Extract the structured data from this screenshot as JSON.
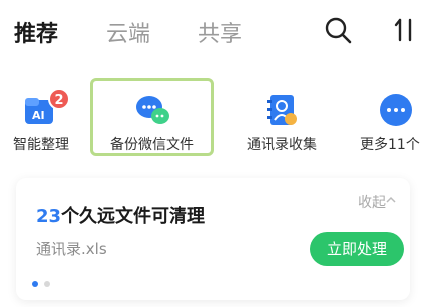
{
  "tabs": [
    {
      "label": "推荐",
      "active": true
    },
    {
      "label": "云端",
      "active": false
    },
    {
      "label": "共享",
      "active": false
    }
  ],
  "header_icons": [
    "search-icon",
    "sort-icon"
  ],
  "shortcuts": [
    {
      "label": "智能整理",
      "icon": "smart-organize-icon",
      "badge": "2"
    },
    {
      "label": "备份微信文件",
      "icon": "wechat-backup-icon"
    },
    {
      "label": "通讯录收集",
      "icon": "contacts-collect-icon"
    },
    {
      "label": "更多11个",
      "icon": "more-icon"
    }
  ],
  "card": {
    "count": "23",
    "title_rest": "个久远文件可清理",
    "collapse_label": "收起",
    "file_name": "通讯录.xls",
    "action_label": "立即处理",
    "page_count": 2,
    "current_page": 1
  },
  "colors": {
    "accent_blue": "#2f7bf0",
    "action_green": "#2cc56b",
    "highlight_green": "#b8dc8a",
    "badge_red": "#ee5a54"
  }
}
